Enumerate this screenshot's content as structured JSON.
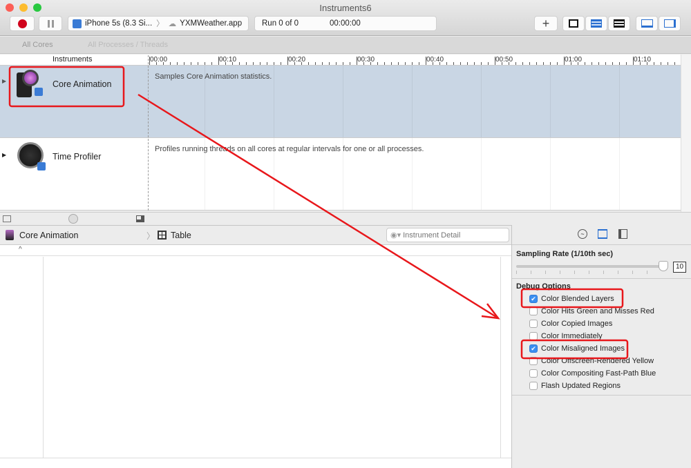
{
  "window": {
    "title": "Instruments6"
  },
  "toolbar": {
    "target_device": "iPhone 5s (8.3 Si...",
    "target_app": "YXMWeather.app",
    "run_status": "Run 0 of 0",
    "elapsed": "00:00:00",
    "add_label": "+"
  },
  "strip": {
    "all_cores": "All Cores",
    "all_processes": "All Processes / Threads"
  },
  "ruler": {
    "header": "Instruments",
    "ticks": [
      "00:00",
      "00:10",
      "00:20",
      "00:30",
      "00:40",
      "00:50",
      "01:00",
      "01:10"
    ]
  },
  "tracks": [
    {
      "name": "Core Animation",
      "description": "Samples Core Animation statistics.",
      "icon": "core-animation-icon"
    },
    {
      "name": "Time Profiler",
      "description": "Profiles running threads on all cores at regular intervals for one or all processes.",
      "icon": "time-profiler-icon"
    }
  ],
  "detail": {
    "instrument": "Core Animation",
    "view": "Table",
    "search_placeholder": "Instrument Detail",
    "sort_indicator": "^"
  },
  "inspector": {
    "sampling_label": "Sampling Rate (1/10th sec)",
    "sampling_value": "10",
    "sampling_fraction": 1.0,
    "debug_title": "Debug Options",
    "options": [
      {
        "label": "Color Blended Layers",
        "checked": true
      },
      {
        "label": "Color Hits Green and Misses Red",
        "checked": false
      },
      {
        "label": "Color Copied Images",
        "checked": false
      },
      {
        "label": "Color Immediately",
        "checked": false
      },
      {
        "label": "Color Misaligned Images",
        "checked": true
      },
      {
        "label": "Color Offscreen-Rendered Yellow",
        "checked": false
      },
      {
        "label": "Color Compositing Fast-Path Blue",
        "checked": false
      },
      {
        "label": "Flash Updated Regions",
        "checked": false
      }
    ]
  },
  "colors": {
    "annotation": "#e8171b",
    "track_selected": "#c9d6e4",
    "accent": "#3b8ff0",
    "record": "#d0021b"
  }
}
